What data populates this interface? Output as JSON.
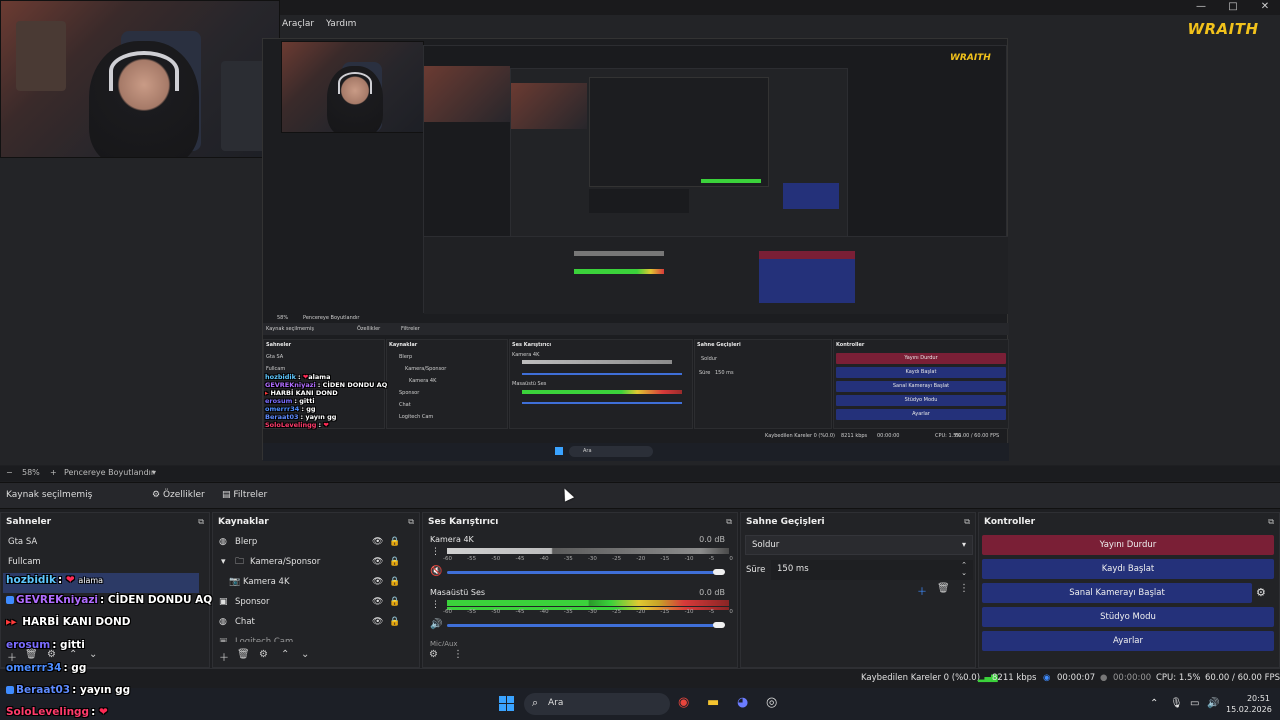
{
  "window": {
    "brand_logo": "WRAITH",
    "controls": [
      "—",
      "□",
      "✕"
    ]
  },
  "nested_menu": [
    "Araçlar",
    "Yardım"
  ],
  "zoom_bar": {
    "minus": "−",
    "percent": "58%",
    "plus": "+",
    "fit_label": "Pencereye Boyutlandır",
    "fit_caret": "▾"
  },
  "toolbar": {
    "no_source": "Kaynak seçilmemiş",
    "properties": "Özellikler",
    "filters": "Filtreler"
  },
  "scenes": {
    "title": "Sahneler",
    "items": [
      "Gta SA",
      "Fullcam"
    ]
  },
  "sources": {
    "title": "Kaynaklar",
    "items": [
      {
        "label": "Blerp",
        "indent": 0
      },
      {
        "label": "Kamera/Sponsor",
        "indent": 1
      },
      {
        "label": "Kamera 4K",
        "indent": 2
      },
      {
        "label": "Sponsor",
        "indent": 0
      },
      {
        "label": "Chat",
        "indent": 0
      },
      {
        "label": "Logitech Cam",
        "indent": 0
      }
    ]
  },
  "mixer": {
    "title": "Ses Karıştırıcı",
    "channels": [
      {
        "name": "Kamera 4K",
        "db": "0.0 dB"
      },
      {
        "name": "Masaüstü Ses",
        "db": "0.0 dB"
      }
    ],
    "partial_next": "Mic/Aux",
    "ticks": [
      "-60",
      "-55",
      "-50",
      "-45",
      "-40",
      "-35",
      "-30",
      "-25",
      "-20",
      "-15",
      "-10",
      "-5",
      "0"
    ]
  },
  "transitions": {
    "title": "Sahne Geçişleri",
    "selected": "Soldur",
    "duration_label": "Süre",
    "duration_value": "150 ms"
  },
  "controls": {
    "title": "Kontroller",
    "buttons": [
      "Yayını Durdur",
      "Kaydı Başlat",
      "Sanal Kamerayı Başlat",
      "Stüdyo Modu",
      "Ayarlar"
    ]
  },
  "status": {
    "dropped": "Kaybedilen Kareler 0 (%0.0)",
    "bitrate": "8211 kbps",
    "stream_time": "00:00:07",
    "rec_time": "00:00:00",
    "cpu": "CPU: 1.5%",
    "fps": "60.00 / 60.00 FPS"
  },
  "taskbar": {
    "search": "Ara",
    "time": "20:51",
    "date": "15.02.2026"
  },
  "chat": [
    {
      "user": "hozbidik",
      "sep": ":",
      "msg": "alama",
      "color": "#5ec8ff"
    },
    {
      "user": "GEVREKniyazi",
      "sep": ":",
      "msg": "CİDEN DONDU AQ",
      "color": "#b06cff"
    },
    {
      "user": "",
      "sep": "",
      "msg": "HARBİ KANI DOND",
      "color": "#ff3b3b"
    },
    {
      "user": "erosum",
      "sep": ":",
      "msg": "gitti",
      "color": "#7a6cff"
    },
    {
      "user": "omerrr34",
      "sep": ":",
      "msg": "gg",
      "color": "#4d8dff"
    },
    {
      "user": "Beraat03",
      "sep": ":",
      "msg": "yayın gg",
      "color": "#5e8bff"
    },
    {
      "user": "SoloLevelingg",
      "sep": ":",
      "msg": "",
      "color": "#ff3b6b"
    }
  ],
  "nested": {
    "zoom_percent": "58%",
    "fit_label": "Pencereye Boyutlandır",
    "no_source": "Kaynak seçilmemiş",
    "properties": "Özellikler",
    "filters": "Filtreler",
    "scenes_title": "Sahneler",
    "sources_title": "Kaynaklar",
    "mixer_title": "Ses Karıştırıcı",
    "transitions_title": "Sahne Geçişleri",
    "controls_title": "Kontroller",
    "scene_items": [
      "Gta SA",
      "Fullcam"
    ],
    "source_items": [
      "Blerp",
      "Kamera/Sponsor",
      "Kamera 4K",
      "Sponsor",
      "Chat",
      "Logitech Cam"
    ],
    "mixer_ch1": "Kamera 4K",
    "mixer_ch2": "Masaüstü Ses",
    "transition_sel": "Soldur",
    "dur_label": "Süre",
    "dur_value": "150 ms",
    "buttons": [
      "Yayını Durdur",
      "Kaydı Başlat",
      "Sanal Kamerayı Başlat",
      "Stüdyo Modu",
      "Ayarlar"
    ],
    "status_dropped": "Kaybedilen Kareler 0 (%0.0)",
    "status_kbps": "8211 kbps",
    "status_time": "00:00:00",
    "status_cpu": "CPU: 1.5%",
    "status_fps": "60.00 / 60.00 FPS",
    "search": "Ara",
    "chat": [
      {
        "user": "hozbidik",
        "msg": "alama",
        "color": "#5ec8ff"
      },
      {
        "user": "GEVREKniyazi",
        "msg": "CİDEN DONDU AQ",
        "color": "#b06cff"
      },
      {
        "user": "",
        "msg": "HARBİ KANI DOND",
        "color": "#ff3b3b"
      },
      {
        "user": "erosum",
        "msg": "gitti",
        "color": "#7a6cff"
      },
      {
        "user": "omerrr34",
        "msg": "gg",
        "color": "#4d8dff"
      },
      {
        "user": "Beraat03",
        "msg": "yayın gg",
        "color": "#5e8bff"
      },
      {
        "user": "SoloLevelingg",
        "msg": "",
        "color": "#ff3b6b"
      }
    ]
  },
  "colors": {
    "stop_button": "#7a1f36",
    "button": "#24317a",
    "meter_green": "#3bd23b",
    "meter_yellow": "#e0c832",
    "meter_red": "#d83a3a",
    "brand": "#f2c21b"
  }
}
